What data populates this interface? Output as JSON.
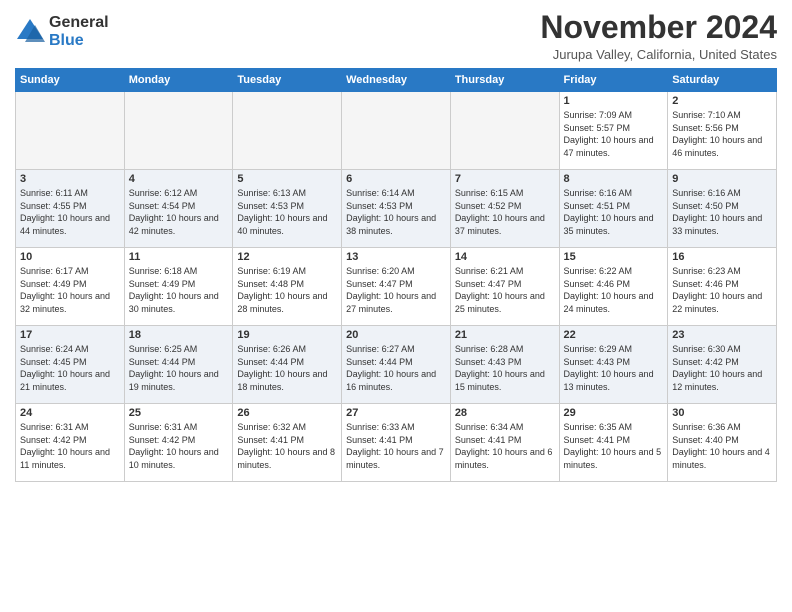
{
  "header": {
    "logo_general": "General",
    "logo_blue": "Blue",
    "month_title": "November 2024",
    "location": "Jurupa Valley, California, United States"
  },
  "days_of_week": [
    "Sunday",
    "Monday",
    "Tuesday",
    "Wednesday",
    "Thursday",
    "Friday",
    "Saturday"
  ],
  "weeks": [
    [
      {
        "day": "",
        "info": ""
      },
      {
        "day": "",
        "info": ""
      },
      {
        "day": "",
        "info": ""
      },
      {
        "day": "",
        "info": ""
      },
      {
        "day": "",
        "info": ""
      },
      {
        "day": "1",
        "info": "Sunrise: 7:09 AM\nSunset: 5:57 PM\nDaylight: 10 hours and 47 minutes."
      },
      {
        "day": "2",
        "info": "Sunrise: 7:10 AM\nSunset: 5:56 PM\nDaylight: 10 hours and 46 minutes."
      }
    ],
    [
      {
        "day": "3",
        "info": "Sunrise: 6:11 AM\nSunset: 4:55 PM\nDaylight: 10 hours and 44 minutes."
      },
      {
        "day": "4",
        "info": "Sunrise: 6:12 AM\nSunset: 4:54 PM\nDaylight: 10 hours and 42 minutes."
      },
      {
        "day": "5",
        "info": "Sunrise: 6:13 AM\nSunset: 4:53 PM\nDaylight: 10 hours and 40 minutes."
      },
      {
        "day": "6",
        "info": "Sunrise: 6:14 AM\nSunset: 4:53 PM\nDaylight: 10 hours and 38 minutes."
      },
      {
        "day": "7",
        "info": "Sunrise: 6:15 AM\nSunset: 4:52 PM\nDaylight: 10 hours and 37 minutes."
      },
      {
        "day": "8",
        "info": "Sunrise: 6:16 AM\nSunset: 4:51 PM\nDaylight: 10 hours and 35 minutes."
      },
      {
        "day": "9",
        "info": "Sunrise: 6:16 AM\nSunset: 4:50 PM\nDaylight: 10 hours and 33 minutes."
      }
    ],
    [
      {
        "day": "10",
        "info": "Sunrise: 6:17 AM\nSunset: 4:49 PM\nDaylight: 10 hours and 32 minutes."
      },
      {
        "day": "11",
        "info": "Sunrise: 6:18 AM\nSunset: 4:49 PM\nDaylight: 10 hours and 30 minutes."
      },
      {
        "day": "12",
        "info": "Sunrise: 6:19 AM\nSunset: 4:48 PM\nDaylight: 10 hours and 28 minutes."
      },
      {
        "day": "13",
        "info": "Sunrise: 6:20 AM\nSunset: 4:47 PM\nDaylight: 10 hours and 27 minutes."
      },
      {
        "day": "14",
        "info": "Sunrise: 6:21 AM\nSunset: 4:47 PM\nDaylight: 10 hours and 25 minutes."
      },
      {
        "day": "15",
        "info": "Sunrise: 6:22 AM\nSunset: 4:46 PM\nDaylight: 10 hours and 24 minutes."
      },
      {
        "day": "16",
        "info": "Sunrise: 6:23 AM\nSunset: 4:46 PM\nDaylight: 10 hours and 22 minutes."
      }
    ],
    [
      {
        "day": "17",
        "info": "Sunrise: 6:24 AM\nSunset: 4:45 PM\nDaylight: 10 hours and 21 minutes."
      },
      {
        "day": "18",
        "info": "Sunrise: 6:25 AM\nSunset: 4:44 PM\nDaylight: 10 hours and 19 minutes."
      },
      {
        "day": "19",
        "info": "Sunrise: 6:26 AM\nSunset: 4:44 PM\nDaylight: 10 hours and 18 minutes."
      },
      {
        "day": "20",
        "info": "Sunrise: 6:27 AM\nSunset: 4:44 PM\nDaylight: 10 hours and 16 minutes."
      },
      {
        "day": "21",
        "info": "Sunrise: 6:28 AM\nSunset: 4:43 PM\nDaylight: 10 hours and 15 minutes."
      },
      {
        "day": "22",
        "info": "Sunrise: 6:29 AM\nSunset: 4:43 PM\nDaylight: 10 hours and 13 minutes."
      },
      {
        "day": "23",
        "info": "Sunrise: 6:30 AM\nSunset: 4:42 PM\nDaylight: 10 hours and 12 minutes."
      }
    ],
    [
      {
        "day": "24",
        "info": "Sunrise: 6:31 AM\nSunset: 4:42 PM\nDaylight: 10 hours and 11 minutes."
      },
      {
        "day": "25",
        "info": "Sunrise: 6:31 AM\nSunset: 4:42 PM\nDaylight: 10 hours and 10 minutes."
      },
      {
        "day": "26",
        "info": "Sunrise: 6:32 AM\nSunset: 4:41 PM\nDaylight: 10 hours and 8 minutes."
      },
      {
        "day": "27",
        "info": "Sunrise: 6:33 AM\nSunset: 4:41 PM\nDaylight: 10 hours and 7 minutes."
      },
      {
        "day": "28",
        "info": "Sunrise: 6:34 AM\nSunset: 4:41 PM\nDaylight: 10 hours and 6 minutes."
      },
      {
        "day": "29",
        "info": "Sunrise: 6:35 AM\nSunset: 4:41 PM\nDaylight: 10 hours and 5 minutes."
      },
      {
        "day": "30",
        "info": "Sunrise: 6:36 AM\nSunset: 4:40 PM\nDaylight: 10 hours and 4 minutes."
      }
    ]
  ]
}
